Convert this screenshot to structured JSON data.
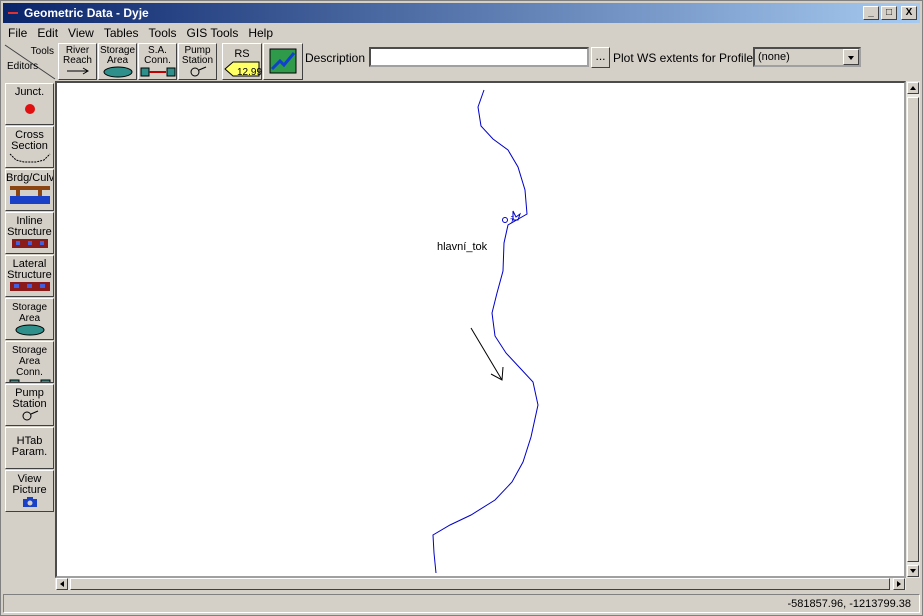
{
  "window": {
    "title": "Geometric Data - Dyje"
  },
  "window_controls": {
    "minimize": "_",
    "maximize": "□",
    "close": "X"
  },
  "menu": [
    "File",
    "Edit",
    "View",
    "Tables",
    "Tools",
    "GIS Tools",
    "Help"
  ],
  "toolbar": {
    "tools_label": "Tools",
    "editors_label": "Editors",
    "buttons": [
      {
        "line1": "River",
        "line2": "Reach",
        "icon": "arrow-icon"
      },
      {
        "line1": "Storage",
        "line2": "Area",
        "icon": "storage-area-icon"
      },
      {
        "line1": "S.A.",
        "line2": "Conn.",
        "icon": "storage-conn-icon"
      },
      {
        "line1": "Pump",
        "line2": "Station",
        "icon": "pump-icon"
      },
      {
        "line1": "RS",
        "line2": "12.99",
        "icon": "rs-tag-icon"
      },
      {
        "icon": "map-background-icon"
      }
    ],
    "description_label": "Description :",
    "description_value": "",
    "dots_label": "...",
    "plot_ws_label": "Plot WS extents for Profile:",
    "profile_selected": "(none)"
  },
  "sidebar": [
    {
      "line1": "Junct.",
      "line2": "",
      "icon": "junction-icon"
    },
    {
      "line1": "Cross",
      "line2": "Section",
      "icon": "cross-section-icon"
    },
    {
      "line1": "Brdg/Culv",
      "line2": "",
      "icon": "bridge-icon"
    },
    {
      "line1": "Inline",
      "line2": "Structure",
      "icon": "inline-structure-icon"
    },
    {
      "line1": "Lateral",
      "line2": "Structure",
      "icon": "lateral-structure-icon"
    },
    {
      "line1": "Storage",
      "line2": "Area",
      "icon": "storage-area-icon"
    },
    {
      "line1": "Storage",
      "line2": "Area Conn.",
      "icon": "storage-conn-icon"
    },
    {
      "line1": "Pump",
      "line2": "Station",
      "icon": "pump-icon"
    },
    {
      "line1": "HTab",
      "line2": "Param.",
      "icon": ""
    },
    {
      "line1": "View",
      "line2": "Picture",
      "icon": "camera-icon"
    }
  ],
  "canvas": {
    "reach_label": "hlavní_tok",
    "river_color": "#0000c8"
  },
  "status": {
    "coordinates": "-581857.96, -1213799.38"
  }
}
